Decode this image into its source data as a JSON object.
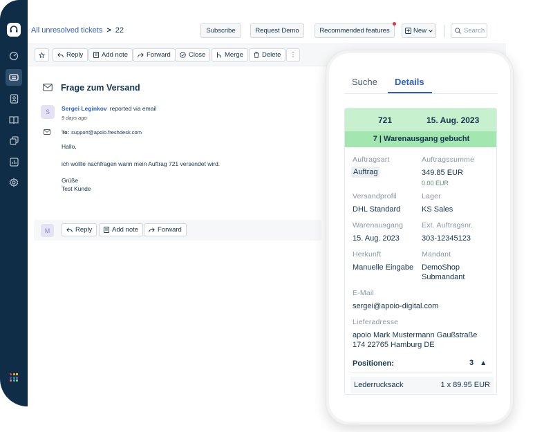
{
  "colors": {
    "sidebar_bg": "#0f2d46",
    "link": "#2c5cc5",
    "text": "#12344d",
    "green_header": "#c7f0cf",
    "green_status": "#a4e6b0",
    "notification_dot": "#e43538"
  },
  "sidebar": {
    "logo_icon": "headset-icon",
    "items": [
      {
        "icon": "dashboard-icon",
        "active": false
      },
      {
        "icon": "ticket-icon",
        "active": true
      },
      {
        "icon": "contacts-icon",
        "active": false
      },
      {
        "icon": "book-icon",
        "active": false
      },
      {
        "icon": "copy-icon",
        "active": false
      },
      {
        "icon": "reports-icon",
        "active": false
      },
      {
        "icon": "settings-icon",
        "active": false
      }
    ],
    "apps_icon": "app-grid-icon"
  },
  "header": {
    "breadcrumb_link": "All unresolved tickets",
    "breadcrumb_sep": ">",
    "breadcrumb_number": "22",
    "buttons": {
      "subscribe": "Subscribe",
      "request_demo": "Request Demo",
      "recommended": "Recommended features",
      "new": "New"
    },
    "search_placeholder": "Search"
  },
  "toolbar": {
    "reply": "Reply",
    "add_note": "Add note",
    "forward": "Forward",
    "close": "Close",
    "merge": "Merge",
    "delete": "Delete",
    "more": "⋮"
  },
  "ticket": {
    "subject": "Frage zum Versand",
    "sender_initial": "S",
    "sender_name": "Sergei Leginkov",
    "via": "reported via email",
    "time": "9 days ago",
    "to_label": "To:",
    "to_address": "support@apoio.freshdesk.com",
    "body": {
      "greeting": "Hallo,",
      "line1": "ich wollte nachfragen wann mein Auftrag 721 versendet wird.",
      "closing": "Grüße",
      "signature": "Test Kunde"
    }
  },
  "reply_bar": {
    "agent_initial": "M",
    "reply": "Reply",
    "add_note": "Add note",
    "forward": "Forward"
  },
  "phone": {
    "tabs": {
      "search": "Suche",
      "details": "Details"
    },
    "order": {
      "id": "721",
      "date": "15. Aug. 2023",
      "status": "7 | Warenausgang gebucht",
      "fields": {
        "auftragsart_label": "Auftragsart",
        "auftragsart": "Auftrag",
        "auftragssumme_label": "Auftragssumme",
        "auftragssumme": "349.85 EUR",
        "auftragssumme_sub": "0.00 EUR",
        "versandprofil_label": "Versandprofil",
        "versandprofil": "DHL Standard",
        "lager_label": "Lager",
        "lager": "KS Sales",
        "warenausgang_label": "Warenausgang",
        "warenausgang": "15. Aug. 2023",
        "ext_label": "Ext. Auftragsnr.",
        "ext": "303-12345123",
        "herkunft_label": "Herkunft",
        "herkunft": "Manuelle Eingabe",
        "mandant_label": "Mandant",
        "mandant_line1": "DemoShop",
        "mandant_line2": "Submandant",
        "email_label": "E-Mail",
        "email": "sergei@apoio-digital.com",
        "lieferadresse_label": "Lieferadresse",
        "lieferadresse_line1": "apoio Mark Mustermann Gaußstraße",
        "lieferadresse_line2": "174 22765 Hamburg DE"
      },
      "positions_label": "Positionen:",
      "positions_count": "3",
      "positions_toggle": "▲",
      "positions": [
        {
          "name": "Lederrucksack",
          "qty": "1 x 89.95 EUR"
        }
      ]
    }
  }
}
